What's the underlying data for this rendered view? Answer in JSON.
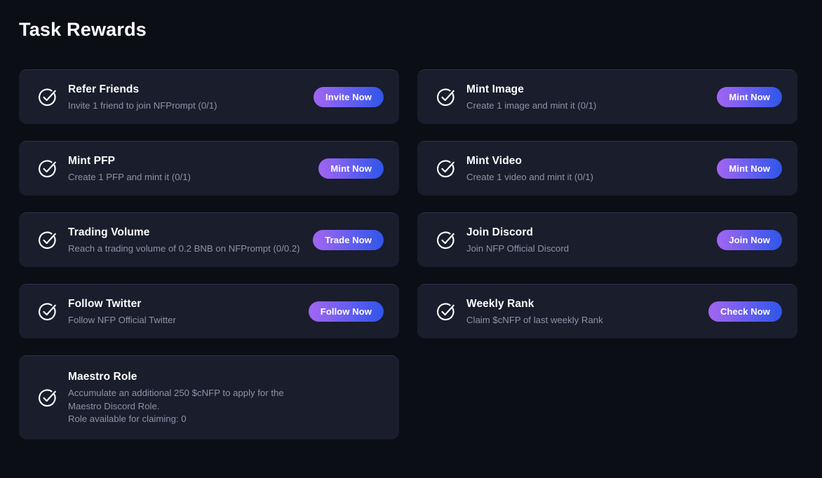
{
  "header": {
    "title": "Task Rewards"
  },
  "theme": {
    "page_background": "#0c0e16",
    "card_background": "#191d2c",
    "title_color": "#ffffff",
    "description_color": "#8c94a8",
    "button_gradient_start": "#a164f2",
    "button_gradient_end": "#2f56e8",
    "icon_color": "#ffffff"
  },
  "tasks": [
    {
      "id": "refer-friends",
      "column": "left",
      "status_icon": "check-circle-icon",
      "title": "Refer Friends",
      "description": "Invite 1 friend to join NFPrompt (0/1)",
      "action_label": "Invite Now",
      "has_action": true
    },
    {
      "id": "mint-image",
      "column": "right",
      "status_icon": "check-circle-icon",
      "title": "Mint Image",
      "description": "Create 1 image and mint it (0/1)",
      "action_label": "Mint Now",
      "has_action": true
    },
    {
      "id": "mint-pfp",
      "column": "left",
      "status_icon": "check-circle-icon",
      "title": "Mint PFP",
      "description": "Create 1 PFP and mint it (0/1)",
      "action_label": "Mint Now",
      "has_action": true
    },
    {
      "id": "mint-video",
      "column": "right",
      "status_icon": "check-circle-icon",
      "title": "Mint Video",
      "description": "Create 1 video and mint it (0/1)",
      "action_label": "Mint Now",
      "has_action": true
    },
    {
      "id": "trading-volume",
      "column": "left",
      "status_icon": "check-circle-icon",
      "title": "Trading Volume",
      "description": "Reach a trading volume of 0.2 BNB on NFPrompt (0/0.2)",
      "action_label": "Trade Now",
      "has_action": true
    },
    {
      "id": "join-discord",
      "column": "right",
      "status_icon": "check-circle-icon",
      "title": "Join Discord",
      "description": "Join NFP Official Discord",
      "action_label": "Join Now",
      "has_action": true
    },
    {
      "id": "follow-twitter",
      "column": "left",
      "status_icon": "check-circle-icon",
      "title": "Follow Twitter",
      "description": "Follow NFP Official Twitter",
      "action_label": "Follow Now",
      "has_action": true
    },
    {
      "id": "weekly-rank",
      "column": "right",
      "status_icon": "check-circle-icon",
      "title": "Weekly Rank",
      "description": "Claim $cNFP of last weekly Rank",
      "action_label": "Check Now",
      "has_action": true
    },
    {
      "id": "maestro-role",
      "column": "left",
      "status_icon": "check-circle-icon",
      "title": "Maestro Role",
      "description": "Accumulate an additional 250 $cNFP to apply for the\nMaestro Discord Role.\nRole available for claiming: 0",
      "action_label": "",
      "has_action": false
    }
  ]
}
